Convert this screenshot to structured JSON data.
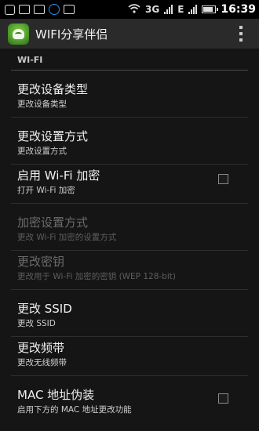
{
  "status_bar": {
    "time": "16:39",
    "network_type": "3G",
    "data_indicator": "E",
    "icons": [
      "add-icon",
      "notification-icon",
      "image-icon",
      "lock-icon",
      "code-icon",
      "wifi-icon",
      "signal-icon",
      "battery-icon"
    ]
  },
  "action_bar": {
    "title": "WIFI分享伴侣",
    "icon": "app-logo-icon",
    "overflow_icon": "overflow-menu-icon"
  },
  "category": {
    "label": "WI-FI"
  },
  "prefs": [
    {
      "title": "更改设备类型",
      "summary": "更改设备类型",
      "enabled": true
    },
    {
      "title": "更改设置方式",
      "summary": "更改设置方式",
      "enabled": true
    },
    {
      "title": "启用 Wi-Fi 加密",
      "summary": "打开 Wi-Fi 加密",
      "enabled": true,
      "checkbox": false
    },
    {
      "title": "加密设置方式",
      "summary": "更改 Wi-Fi 加密的设置方式",
      "enabled": false
    },
    {
      "title": "更改密钥",
      "summary": "更改用于 Wi-Fi 加密的密钥 (WEP 128-bit)",
      "enabled": false
    },
    {
      "title": "更改 SSID",
      "summary": "更改 SSID",
      "enabled": true
    },
    {
      "title": "更改频带",
      "summary": "更改无线频带",
      "enabled": true
    },
    {
      "title": "MAC 地址伪装",
      "summary": "启用下方的 MAC 地址更改功能",
      "enabled": true,
      "checkbox": false
    }
  ],
  "colors": {
    "background": "#151515",
    "action_bar": "#2a2a2a",
    "text": "#f0f0f0",
    "disabled_text": "#6b6b6b"
  }
}
